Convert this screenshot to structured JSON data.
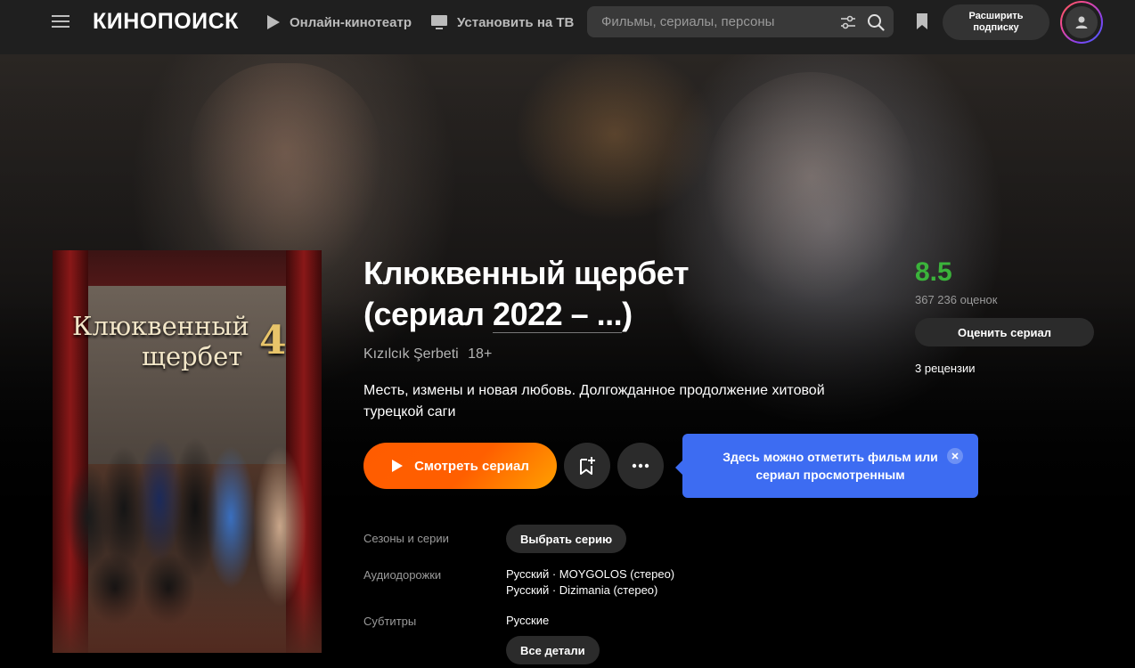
{
  "header": {
    "logo_text": "КИНОПОИСК",
    "nav": [
      {
        "label": "Онлайн-кинотеатр",
        "icon": "play-icon"
      },
      {
        "label": "Установить на ТВ",
        "icon": "tv-icon"
      }
    ],
    "search_placeholder": "Фильмы, сериалы, персоны",
    "subscribe_line1": "Расширить",
    "subscribe_line2": "подписку"
  },
  "movie": {
    "title_line1": "Клюквенный щербет",
    "title_line2_prefix": "(сериал ",
    "title_year": "2022 – ...",
    "title_line2_suffix": ")",
    "original_title": "Kızılcık Şerbeti",
    "age_rating": "18+",
    "description": "Месть, измены и новая любовь. Долгожданное продолжение хитовой турецкой саги",
    "poster_title_line1": "Клюквенный",
    "poster_title_line2": "щербет",
    "poster_season": "4"
  },
  "actions": {
    "watch_label": "Смотреть сериал",
    "tooltip_text": "Здесь можно отметить фильм или сериал просмотренным"
  },
  "rating": {
    "value": "8.5",
    "votes": "367 236 оценок",
    "rate_label": "Оценить сериал",
    "reviews": "3 рецензии",
    "color": "#3bb33b"
  },
  "details": {
    "seasons_label": "Сезоны и серии",
    "seasons_button": "Выбрать серию",
    "audio_label": "Аудиодорожки",
    "audio_1": "Русский · MOYGOLOS (стерео)",
    "audio_2": "Русский · Dizimania (стерео)",
    "subs_label": "Субтитры",
    "subs_value": "Русские",
    "all_details": "Все детали"
  },
  "colors": {
    "accent_orange": "#ff5c00",
    "tooltip_blue": "#3d6cf2"
  }
}
